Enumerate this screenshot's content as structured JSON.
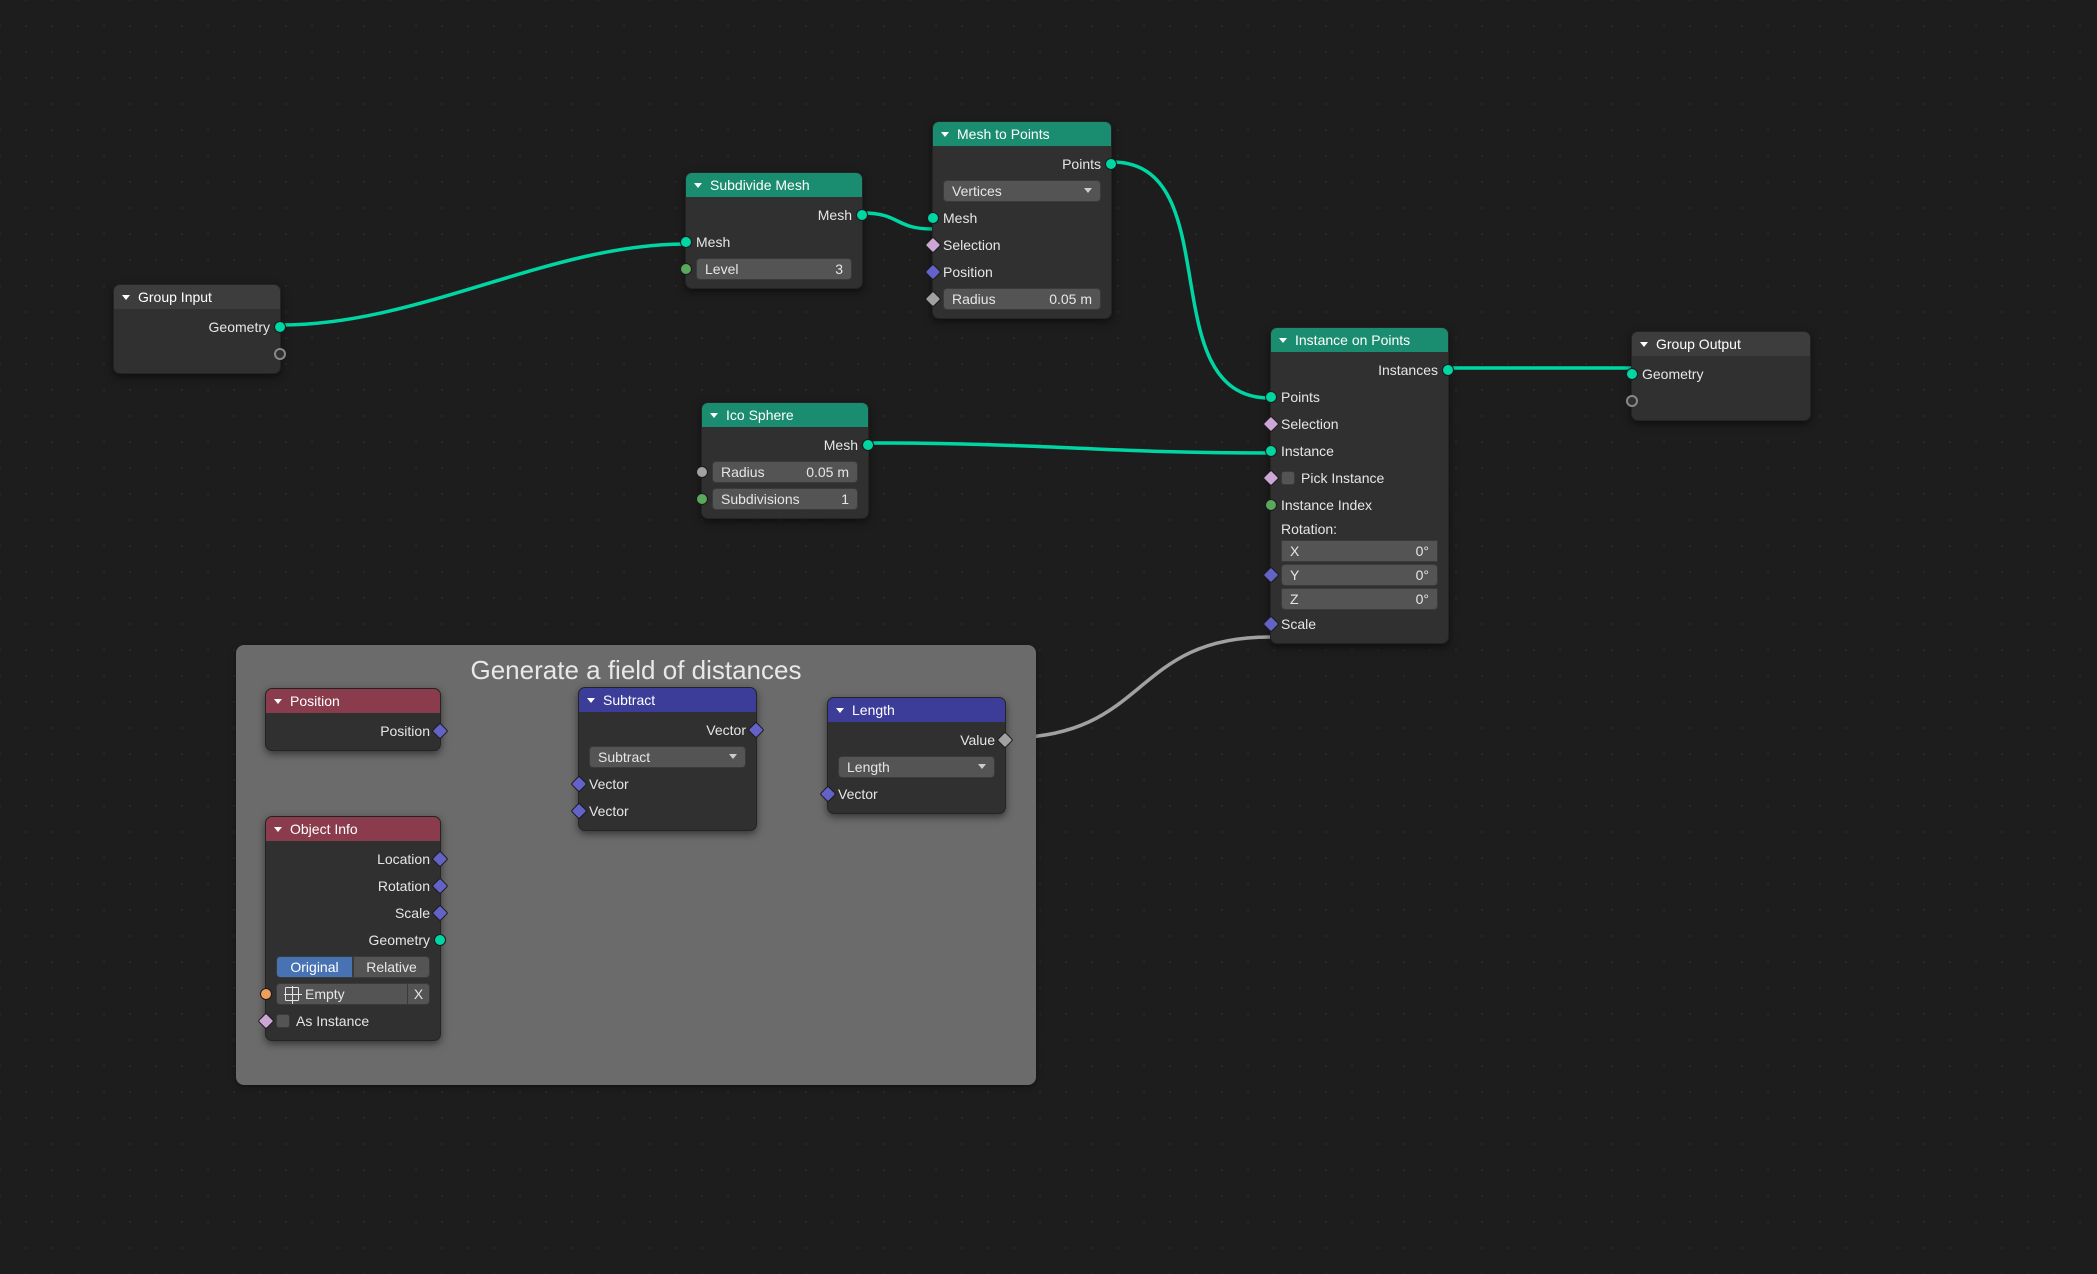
{
  "frame": {
    "title": "Generate a field of distances"
  },
  "nodes": {
    "group_input": {
      "title": "Group Input",
      "outputs": {
        "geometry": "Geometry"
      }
    },
    "subdiv": {
      "title": "Subdivide Mesh",
      "outputs": {
        "mesh": "Mesh"
      },
      "inputs": {
        "mesh": "Mesh"
      },
      "level": {
        "label": "Level",
        "value": "3"
      }
    },
    "m2p": {
      "title": "Mesh to Points",
      "outputs": {
        "points": "Points"
      },
      "mode": "Vertices",
      "inputs": {
        "mesh": "Mesh",
        "selection": "Selection",
        "position": "Position"
      },
      "radius": {
        "label": "Radius",
        "value": "0.05 m"
      }
    },
    "ico": {
      "title": "Ico Sphere",
      "outputs": {
        "mesh": "Mesh"
      },
      "radius": {
        "label": "Radius",
        "value": "0.05 m"
      },
      "subdiv": {
        "label": "Subdivisions",
        "value": "1"
      }
    },
    "iop": {
      "title": "Instance on Points",
      "outputs": {
        "instances": "Instances"
      },
      "inputs": {
        "points": "Points",
        "selection": "Selection",
        "instance": "Instance",
        "pick": "Pick Instance",
        "index": "Instance Index",
        "rotation": "Rotation:",
        "scale": "Scale"
      },
      "rot": {
        "x_l": "X",
        "x_v": "0°",
        "y_l": "Y",
        "y_v": "0°",
        "z_l": "Z",
        "z_v": "0°"
      }
    },
    "group_output": {
      "title": "Group Output",
      "inputs": {
        "geometry": "Geometry"
      }
    },
    "position": {
      "title": "Position",
      "outputs": {
        "position": "Position"
      }
    },
    "objinfo": {
      "title": "Object Info",
      "outputs": {
        "location": "Location",
        "rotation": "Rotation",
        "scale": "Scale",
        "geometry": "Geometry"
      },
      "toggle": {
        "on": "Original",
        "off": "Relative"
      },
      "object": "Empty",
      "close_x": "X",
      "as_instance": "As Instance"
    },
    "subtract": {
      "title": "Subtract",
      "outputs": {
        "vector": "Vector"
      },
      "mode": "Subtract",
      "inputs": {
        "a": "Vector",
        "b": "Vector"
      }
    },
    "length": {
      "title": "Length",
      "outputs": {
        "value": "Value"
      },
      "mode": "Length",
      "inputs": {
        "vector": "Vector"
      }
    }
  }
}
